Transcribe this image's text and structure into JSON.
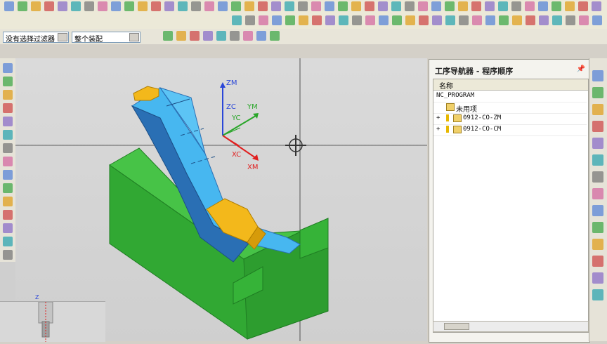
{
  "toolbar": {
    "filter_select": "没有选择过滤器",
    "assembly_select": "整个装配"
  },
  "navigator": {
    "title": "工序导航器 - 程序顺序",
    "column_name": "名称",
    "rows": [
      {
        "label": "NC_PROGRAM",
        "expander": "",
        "icon": ""
      },
      {
        "label": "未用项",
        "expander": "",
        "icon": "folder-icon"
      },
      {
        "label": "0912-CO-ZM",
        "expander": "+",
        "icon": "program-folder-icon"
      },
      {
        "label": "0912-CO-CM",
        "expander": "+",
        "icon": "program-folder-icon"
      }
    ]
  },
  "axes": {
    "zm": "ZM",
    "zc": "ZC",
    "yc": "YC",
    "ym": "YM",
    "xc": "XC",
    "xm": "XM"
  },
  "preview": {
    "z_label": "Z"
  },
  "colors": {
    "base": "#31a833",
    "base_dark": "#1f7d23",
    "slide": "#47b7f0",
    "slide_dark": "#2a6fb4",
    "insert": "#f3b81b",
    "red_axis": "#e02020",
    "blue_axis": "#2a46d8",
    "green_axis": "#29a629"
  }
}
